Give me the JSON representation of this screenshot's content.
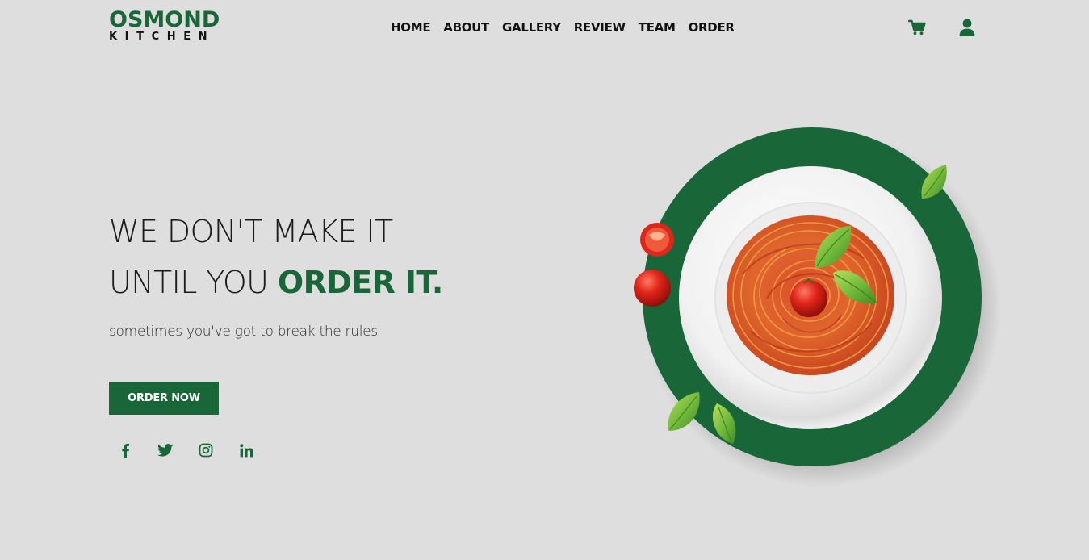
{
  "brand": {
    "name_top": "OSMOND",
    "name_bottom": "KITCHEN"
  },
  "nav": {
    "items": [
      "HOME",
      "ABOUT",
      "GALLERY",
      "REVIEW",
      "TEAM",
      "ORDER"
    ]
  },
  "header_icons": {
    "cart": "cart-icon",
    "user": "user-icon"
  },
  "hero": {
    "line1": "WE DON'T MAKE IT",
    "line2_prefix": "UNTIL YOU",
    "line2_accent": "ORDER IT.",
    "subtitle": "sometimes you've got to break the rules",
    "cta_label": "ORDER NOW"
  },
  "socials": [
    "facebook-icon",
    "twitter-icon",
    "instagram-icon",
    "linkedin-icon"
  ],
  "colors": {
    "accent": "#196638",
    "background": "#dedede",
    "text": "#111111"
  }
}
